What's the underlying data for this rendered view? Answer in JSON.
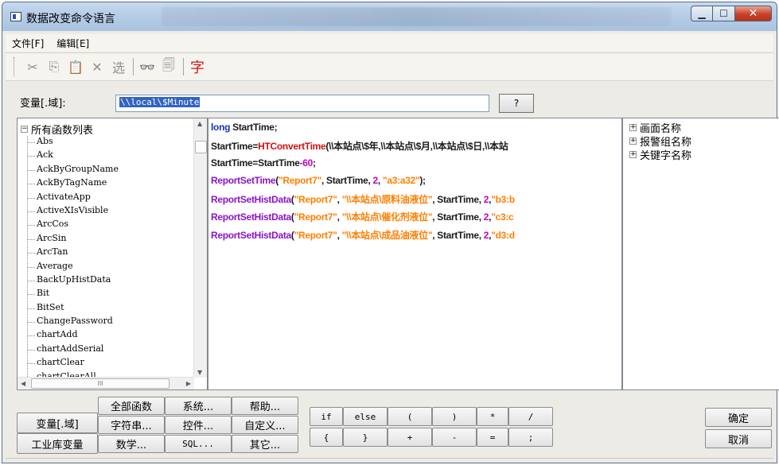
{
  "window": {
    "title": "数据改变命令语言"
  },
  "menu": [
    "文件[F]",
    "编辑[E]"
  ],
  "toolbar": {
    "cut": "✂",
    "copy": "⎘",
    "paste": "📋",
    "delete": "✕",
    "select": "选",
    "find": "👓",
    "replace": "🗐",
    "font": "字"
  },
  "variable": {
    "label": "变量[.域]:",
    "value": "\\\\local\\$Minute",
    "button": "?"
  },
  "functions": {
    "root": "所有函数列表",
    "items": [
      "Abs",
      "Ack",
      "AckByGroupName",
      "AckByTagName",
      "ActivateApp",
      "ActiveXIsVisible",
      "ArcCos",
      "ArcSin",
      "ArcTan",
      "Average",
      "BackUpHistData",
      "Bit",
      "BitSet",
      "ChangePassword",
      "chartAdd",
      "chartAddSerial",
      "chartClear",
      "chartClearAll"
    ],
    "hscroll_label": "III"
  },
  "code": {
    "line1": [
      "long",
      " StartTime;"
    ],
    "line2": [
      "StartTime=",
      "HTConvertTime",
      "(\\\\本站点\\$年,\\\\本站点\\$月,\\\\本站点\\$日,\\\\本站"
    ],
    "line3": [
      "StartTime=StartTime",
      "-60",
      ";"
    ],
    "line4": [
      "ReportSetTime",
      "(",
      "\"Report7\"",
      ", StartTime, ",
      "2",
      ", ",
      "\"a3:a32\"",
      ");"
    ],
    "line5": [
      "ReportSetHistData",
      "(",
      "\"Report7\"",
      ", ",
      "\"\\\\本站点\\原料油液位\"",
      ", StartTime, ",
      "2",
      ",",
      "\"b3:b"
    ],
    "line6": [
      "ReportSetHistData",
      "(",
      "\"Report7\"",
      ", ",
      "\"\\\\本站点\\催化剂液位\"",
      ", StartTime, ",
      "2",
      ",",
      "\"c3:c"
    ],
    "line7": [
      "ReportSetHistData",
      "(",
      "\"Report7\"",
      ", ",
      "\"\\\\本站点\\成品油液位\"",
      ", StartTime, ",
      "2",
      ",",
      "\"d3:d"
    ]
  },
  "names": [
    "画面名称",
    "报警组名称",
    "关键字名称"
  ],
  "buttons": {
    "var_domain": "变量[.域]",
    "tag_var": "工业库变量",
    "all_funcs": "全部函数",
    "string": "字符串...",
    "math": "数学...",
    "system": "系统...",
    "control": "控件...",
    "sql": "SQL...",
    "help": "帮助...",
    "custom": "自定义...",
    "other": "其它...",
    "ok": "确定",
    "cancel": "取消"
  },
  "operators": {
    "row1": [
      "if",
      "else",
      "(",
      ")",
      "*",
      "/"
    ],
    "row2": [
      "{",
      "}",
      "+",
      "-",
      "=",
      ";"
    ]
  }
}
